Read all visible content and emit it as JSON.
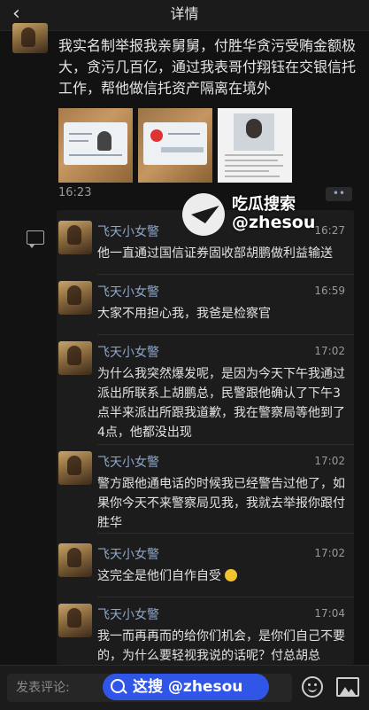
{
  "nav": {
    "title": "详情"
  },
  "post": {
    "text": "我实名制举报我亲舅舅，付胜华贪污受贿金额极大，贪污几百亿，通过我表哥付翔钰在交银信托工作，帮他做信托资产隔离在境外",
    "time": "16:23",
    "more_label": "••",
    "photo3_caption": "付胜华"
  },
  "comments": [
    {
      "name": "飞天小女警",
      "time": "16:27",
      "text": "他一直通过国信证券固收部胡鹏做利益输送"
    },
    {
      "name": "飞天小女警",
      "time": "16:59",
      "text": "大家不用担心我，我爸是检察官"
    },
    {
      "name": "飞天小女警",
      "time": "17:02",
      "text": "为什么我突然爆发呢，是因为今天下午我通过派出所联系上胡鹏总，民警跟他确认了下午3点半来派出所跟我道歉，我在警察局等他到了4点，他都没出现"
    },
    {
      "name": "飞天小女警",
      "time": "17:02",
      "text": "警方跟他通电话的时候我已经警告过他了，如果你今天不来警察局见我，我就去举报你跟付胜华"
    },
    {
      "name": "飞天小女警",
      "time": "17:02",
      "text": "这完全是他们自作自受"
    },
    {
      "name": "飞天小女警",
      "time": "17:04",
      "text": "我一而再再而的给你们机会，是你们自己不要的，为什么要轻视我说的话呢？付总胡总"
    }
  ],
  "input": {
    "placeholder": "发表评论:"
  },
  "watermark": {
    "title": "吃瓜搜索",
    "handle": "@zhesou",
    "banner": "这搜 @zhesou"
  },
  "colors": {
    "background": "#121212",
    "name_link": "#8fa7c8",
    "banner": "#2f56e6"
  }
}
